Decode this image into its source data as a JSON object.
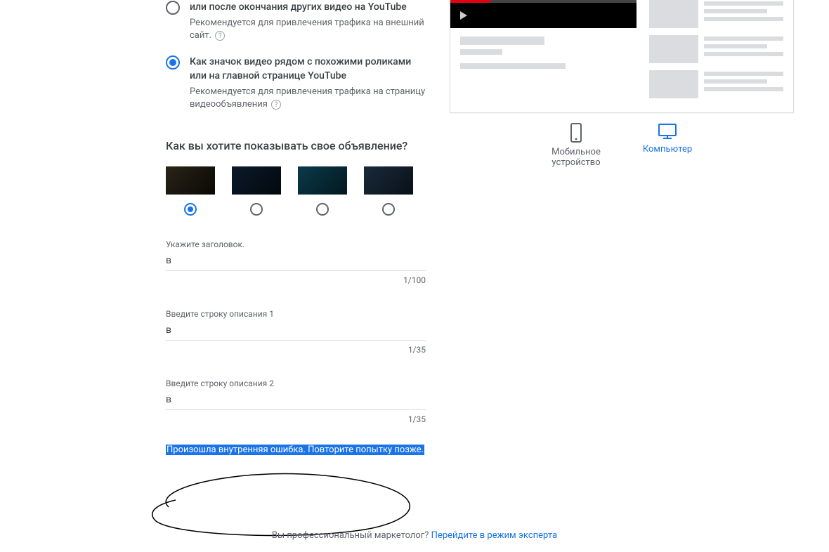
{
  "options": {
    "opt1": {
      "title": "или после окончания других видео на YouTube",
      "sub": "Рекомендуется для привлечения трафика на внешний сайт."
    },
    "opt2": {
      "title": "Как значок видео рядом с похожими роликами или на главной странице YouTube",
      "sub": "Рекомендуется для привлечения трафика на страницу видеообъявления"
    }
  },
  "section_heading": "Как вы хотите показывать свое объявление?",
  "fields": {
    "headline": {
      "label": "Укажите заголовок.",
      "value": "в",
      "counter": "1/100"
    },
    "desc1": {
      "label": "Введите строку описания 1",
      "value": "в",
      "counter": "1/35"
    },
    "desc2": {
      "label": "Введите строку описания 2",
      "value": "в",
      "counter": "1/35"
    }
  },
  "error": "Произошла внутренняя ошибка. Повторите попытку позже.",
  "devices": {
    "mobile": "Мобильное устройство",
    "desktop": "Компьютер"
  },
  "footer": {
    "question": "Вы профессиональный маркетолог? ",
    "link": "Перейдите в режим эксперта"
  }
}
